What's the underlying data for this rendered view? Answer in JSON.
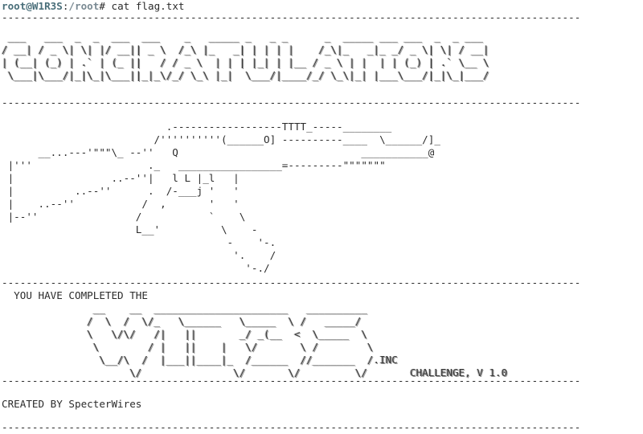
{
  "colors": {
    "background": "#ffffff",
    "text": "#2b2b2b",
    "prompt_user": "#4a6f7a",
    "prompt_path": "#7a8a93"
  },
  "prompt": {
    "user_host": "root@W1R3S",
    "separator": ":",
    "path": "/root",
    "symbol": "# ",
    "command": "cat flag.txt"
  },
  "divider": "-----------------------------------------------------------------------------------------------",
  "divider_short": "-----------------------------------------------------------------------------------------------",
  "congrats_art": [
    " ___   ___  _  _  ___  ___    _   _____ _   _ _      _  _____ ___ ___  _  _ ___ ",
    "/ __| / _ \\| \\| |/ __|| _ \\  /_\\ |_   _| | | | |    /_\\|_   _|_ _/ _ \\| \\| / __|",
    "| (__| (_) | .` | (_ ||   / / _ \\  | | | |_| | |__ / _ \\ | |  | | (_) | .` \\__ \\",
    " \\___|\\___/|_|\\_|\\___||_|_\\/_/ \\_\\ |_|  \\___/|____/_/ \\_\\|_| |___\\___/|_|\\_|___/"
  ],
  "rifle_art": [
    "                           .------------------TTTT_-----________",
    "                         /''''''''''(______O] ----------____  \\______/]_",
    "      __...---'\"\"\"\\_ --''   Q                              ___________@",
    " |'''                   ._   _________________=---------\"\"\"\"\"\"\"",
    " |                ..--''|   l L |_l   |",
    " |          ..--''      .  /-___j '   '",
    " |    ..--''           /  ,       '   '",
    " |--''                /           `    \\",
    "                      L__'          \\    -",
    "                                     -    '-.",
    "                                      '.    /",
    "                                        '-./"
  ],
  "completed_text": "  YOU HAVE COMPLETED THE",
  "wires_art": [
    "               __    __  ______________________   __________",
    "              /  \\  /  \\/_   \\______   \\_____  \\ /   _____/",
    "              \\   \\/\\/   /|   ||       _/ _(__  <  \\_____  \\",
    "               \\        / |   ||    |   \\/       \\ /        \\",
    "                \\__/\\  /  |___||____|_  /______  //_______  /.INC",
    "                     \\/               \\/       \\/         \\/       CHALLENGE, V 1.0"
  ],
  "credits": "CREATED BY SpecterWires"
}
